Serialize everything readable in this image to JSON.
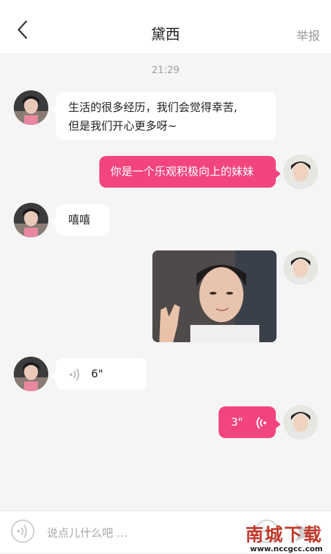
{
  "header": {
    "title": "黛西",
    "report_label": "举报"
  },
  "chat": {
    "time": "21:29",
    "messages": [
      {
        "side": "in",
        "text_line1": "生活的很多经历，我们会觉得幸苦,",
        "text_line2": "但是我们开心更多呀~"
      },
      {
        "side": "out",
        "text": "你是一个乐观积极向上的妹妹"
      },
      {
        "side": "in",
        "text": "嘻嘻"
      },
      {
        "side": "out",
        "type": "image"
      },
      {
        "side": "in",
        "type": "voice",
        "duration": "6\""
      },
      {
        "side": "out",
        "type": "voice",
        "duration": "3\""
      }
    ]
  },
  "input": {
    "placeholder": "说点儿什么吧 ..."
  },
  "watermark": {
    "main": "南城下载",
    "sub": "www.nccgcc.com"
  },
  "colors": {
    "accent": "#f2457d",
    "incoming_bubble": "#ffffff",
    "background": "#f5f5f5"
  }
}
